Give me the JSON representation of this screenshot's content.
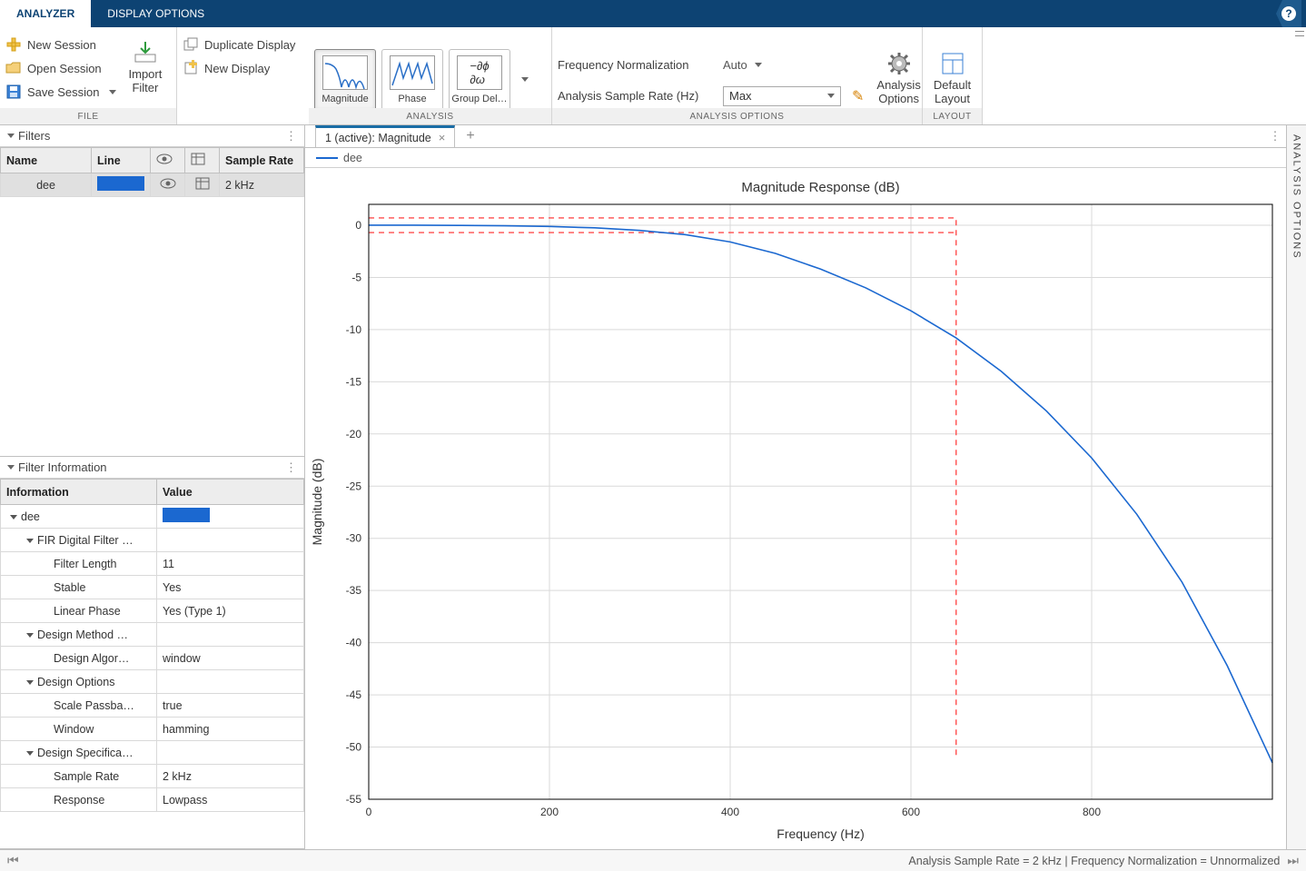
{
  "tabs": {
    "analyzer": "ANALYZER",
    "display_options": "DISPLAY OPTIONS"
  },
  "toolstrip": {
    "file": {
      "label": "FILE",
      "new_session": "New Session",
      "open_session": "Open Session",
      "save_session": "Save Session",
      "import_filter": "Import\nFilter"
    },
    "display_group": {
      "duplicate_display": "Duplicate Display",
      "new_display": "New Display"
    },
    "analysis": {
      "label": "ANALYSIS",
      "magnitude": "Magnitude",
      "phase": "Phase",
      "group_delay": "Group Del…"
    },
    "analysis_options": {
      "label": "ANALYSIS OPTIONS",
      "freq_norm_label": "Frequency Normalization",
      "freq_norm_value": "Auto",
      "sample_rate_label": "Analysis Sample Rate (Hz)",
      "sample_rate_value": "Max",
      "analysis_options_btn": "Analysis\nOptions"
    },
    "layout": {
      "label": "LAYOUT",
      "default_layout": "Default\nLayout"
    }
  },
  "filters_panel": {
    "title": "Filters",
    "headers": {
      "name": "Name",
      "line": "Line",
      "sample_rate": "Sample Rate"
    },
    "rows": [
      {
        "name": "dee",
        "sample_rate": "2 kHz"
      }
    ]
  },
  "info_panel": {
    "title": "Filter Information",
    "headers": {
      "info": "Information",
      "value": "Value"
    },
    "rows": [
      {
        "k": "dee",
        "v": "",
        "indent": 0,
        "exp": true,
        "chip": true
      },
      {
        "k": "FIR Digital Filter …",
        "v": "",
        "indent": 1,
        "exp": true
      },
      {
        "k": "Filter Length",
        "v": "11",
        "indent": 2
      },
      {
        "k": "Stable",
        "v": "Yes",
        "indent": 2
      },
      {
        "k": "Linear Phase",
        "v": "Yes (Type 1)",
        "indent": 2
      },
      {
        "k": "Design Method …",
        "v": "",
        "indent": 1,
        "exp": true
      },
      {
        "k": "Design Algor…",
        "v": "window",
        "indent": 2
      },
      {
        "k": "Design Options",
        "v": "",
        "indent": 1,
        "exp": true
      },
      {
        "k": "Scale Passba…",
        "v": "true",
        "indent": 2
      },
      {
        "k": "Window",
        "v": "hamming",
        "indent": 2
      },
      {
        "k": "Design Specifica…",
        "v": "",
        "indent": 1,
        "exp": true
      },
      {
        "k": "Sample Rate",
        "v": "2 kHz",
        "indent": 2
      },
      {
        "k": "Response",
        "v": "Lowpass",
        "indent": 2
      }
    ]
  },
  "doc_tab": {
    "label": "1 (active): Magnitude"
  },
  "legend": {
    "name": "dee"
  },
  "right_panel_title": "ANALYSIS OPTIONS",
  "statusbar": {
    "text": "Analysis Sample Rate = 2 kHz | Frequency Normalization = Unnormalized"
  },
  "chart_data": {
    "type": "line",
    "title": "Magnitude Response (dB)",
    "xlabel": "Frequency (Hz)",
    "ylabel": "Magnitude (dB)",
    "xlim": [
      0,
      1000
    ],
    "ylim": [
      -55,
      2
    ],
    "xticks": [
      0,
      200,
      400,
      600,
      800
    ],
    "yticks": [
      0,
      -5,
      -10,
      -15,
      -20,
      -25,
      -30,
      -35,
      -40,
      -45,
      -50,
      -55
    ],
    "series": [
      {
        "name": "dee",
        "color": "#1b68d0",
        "x": [
          0,
          50,
          100,
          150,
          200,
          250,
          300,
          350,
          400,
          450,
          500,
          550,
          600,
          650,
          700,
          750,
          800,
          850,
          900,
          950,
          1000
        ],
        "y": [
          0.0,
          0.0,
          -0.02,
          -0.05,
          -0.12,
          -0.25,
          -0.5,
          -0.9,
          -1.6,
          -2.7,
          -4.2,
          -6.0,
          -8.2,
          -10.8,
          -14.0,
          -17.8,
          -22.3,
          -27.7,
          -34.2,
          -42.2,
          -51.5
        ]
      }
    ],
    "spec_mask": {
      "color": "#ff4d4d",
      "passband_edge_hz": 650,
      "passband_ripple_db_top": 0.7,
      "passband_ripple_db_bottom": -0.7,
      "stopband_start_db": -51
    }
  }
}
